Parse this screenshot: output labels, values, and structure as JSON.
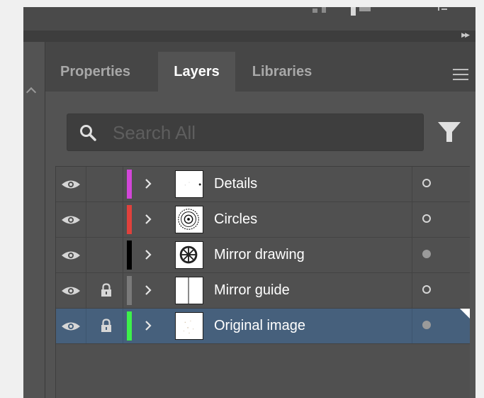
{
  "tabs": [
    {
      "label": "Properties",
      "active": false
    },
    {
      "label": "Layers",
      "active": true
    },
    {
      "label": "Libraries",
      "active": false
    }
  ],
  "search": {
    "placeholder": "Search All",
    "value": ""
  },
  "icons": {
    "collapse": "double-chevron-right-icon",
    "menu": "hamburger-icon",
    "search": "search-icon",
    "filter": "filter-icon",
    "visibility": "eye-icon",
    "lock": "lock-icon",
    "expand": "chevron-right-icon",
    "target": "circle-icon"
  },
  "layers": [
    {
      "name": "Details",
      "color": "#d246d8",
      "visible": true,
      "locked": false,
      "target": "empty",
      "selected": false
    },
    {
      "name": "Circles",
      "color": "#e0413c",
      "visible": true,
      "locked": false,
      "target": "empty",
      "selected": false
    },
    {
      "name": "Mirror drawing",
      "color": "#000000",
      "visible": true,
      "locked": false,
      "target": "filled",
      "selected": false
    },
    {
      "name": "Mirror guide",
      "color": "#7a7a7a",
      "visible": true,
      "locked": true,
      "target": "empty",
      "selected": false
    },
    {
      "name": "Original image",
      "color": "#3df04b",
      "visible": true,
      "locked": true,
      "target": "filled",
      "selected": true
    }
  ]
}
